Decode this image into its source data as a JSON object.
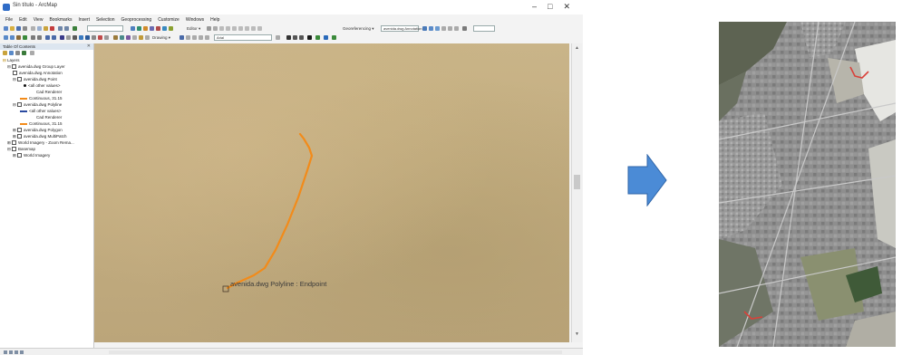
{
  "window": {
    "title": "Sin título - ArcMap",
    "controls": [
      "–",
      "□",
      "✕"
    ]
  },
  "menu": [
    "File",
    "Edit",
    "View",
    "Bookmarks",
    "Insert",
    "Selection",
    "Geoprocessing",
    "Customize",
    "Windows",
    "Help"
  ],
  "toolbar": {
    "editor_label": "Editor ▾",
    "drawing_label": "Drawing ▾",
    "font_value": "Arial",
    "georef_label": "Georeferencing ▾",
    "layer_value": "avenida.dwg Annotation",
    "scale_value": ""
  },
  "toc": {
    "title": "Table Of Contents",
    "close": "✕",
    "root": "Layers",
    "items": [
      {
        "label": "avenida.dwg Group Layer",
        "level": 1
      },
      {
        "label": "avenida.dwg Annotation",
        "level": 2
      },
      {
        "label": "avenida.dwg Point",
        "level": 2
      },
      {
        "label": "<all other values>",
        "level": 3
      },
      {
        "label": "Cad Renderer",
        "level": 4
      },
      {
        "label": "Continuous, 31.15",
        "level": 3
      },
      {
        "label": "avenida.dwg Polyline",
        "level": 2,
        "selected": true
      },
      {
        "label": "<all other values>",
        "level": 3
      },
      {
        "label": "Cad Renderer",
        "level": 4
      },
      {
        "label": "Continuous, 31.15",
        "level": 3
      },
      {
        "label": "avenida.dwg Polygon",
        "level": 2
      },
      {
        "label": "avenida.dwg MultiPatch",
        "level": 2
      },
      {
        "label": "World Imagery - Zoom Rema...",
        "level": 1
      },
      {
        "label": "Basemap",
        "level": 1
      },
      {
        "label": "World Imagery",
        "level": 2
      }
    ]
  },
  "map": {
    "label": "avenida.dwg Polyline : Endpoint",
    "line_color": "#f28b1a"
  },
  "colors": {
    "arrow": "#4b8bd6",
    "selection": "#3399ff",
    "map_bg": "#c4ad80"
  }
}
